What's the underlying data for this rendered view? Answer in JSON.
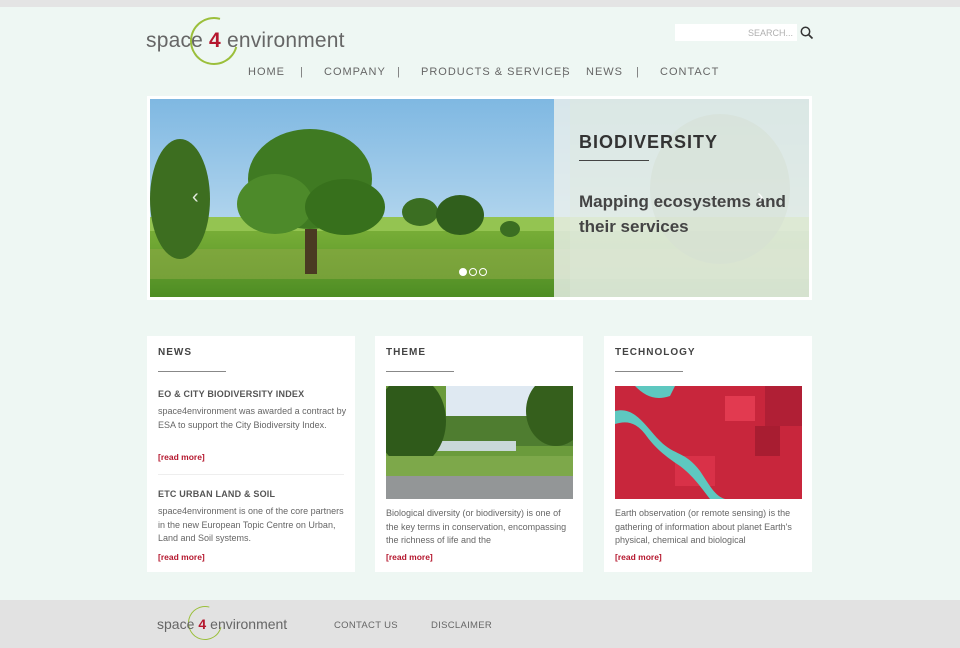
{
  "logo": {
    "left": "space",
    "four": "4",
    "right": "environment"
  },
  "search": {
    "placeholder": "SEARCH..."
  },
  "nav": {
    "items": [
      "HOME",
      "COMPANY",
      "PRODUCTS & SERVICES",
      "NEWS",
      "CONTACT"
    ],
    "separator": "|"
  },
  "slider": {
    "title": "BIODIVERSITY",
    "text": "Mapping ecosystems and their services",
    "prev_arrow": "‹",
    "next_arrow": "›"
  },
  "cards": {
    "news": {
      "title": "NEWS",
      "items": [
        {
          "heading": "EO & CITY BIODIVERSITY INDEX",
          "text": "space4environment was awarded a contract by ESA to support the City Biodiversity Index.",
          "link": "[read more]"
        },
        {
          "heading": "ETC URBAN LAND & SOIL",
          "text": "space4environment is one of the core partners in the new European Topic Centre on Urban, Land and Soil systems.",
          "link": "[read more]"
        }
      ]
    },
    "theme": {
      "title": "THEME",
      "text": "Biological diversity (or biodiversity) is one of the key terms in conservation, encompassing the richness of life and the",
      "link": "[read more]"
    },
    "technology": {
      "title": "TECHNOLOGY",
      "text": "Earth observation (or remote sensing) is the gathering of information about planet Earth's physical, chemical and biological",
      "link": "[read more]"
    }
  },
  "footer": {
    "logo": {
      "left": "space",
      "four": "4",
      "right": "environment"
    },
    "links": [
      "CONTACT US",
      "DISCLAIMER"
    ]
  },
  "colors": {
    "accent": "#b5172e",
    "logo_ring": "#9bbf3b",
    "background": "#eef7f3"
  }
}
